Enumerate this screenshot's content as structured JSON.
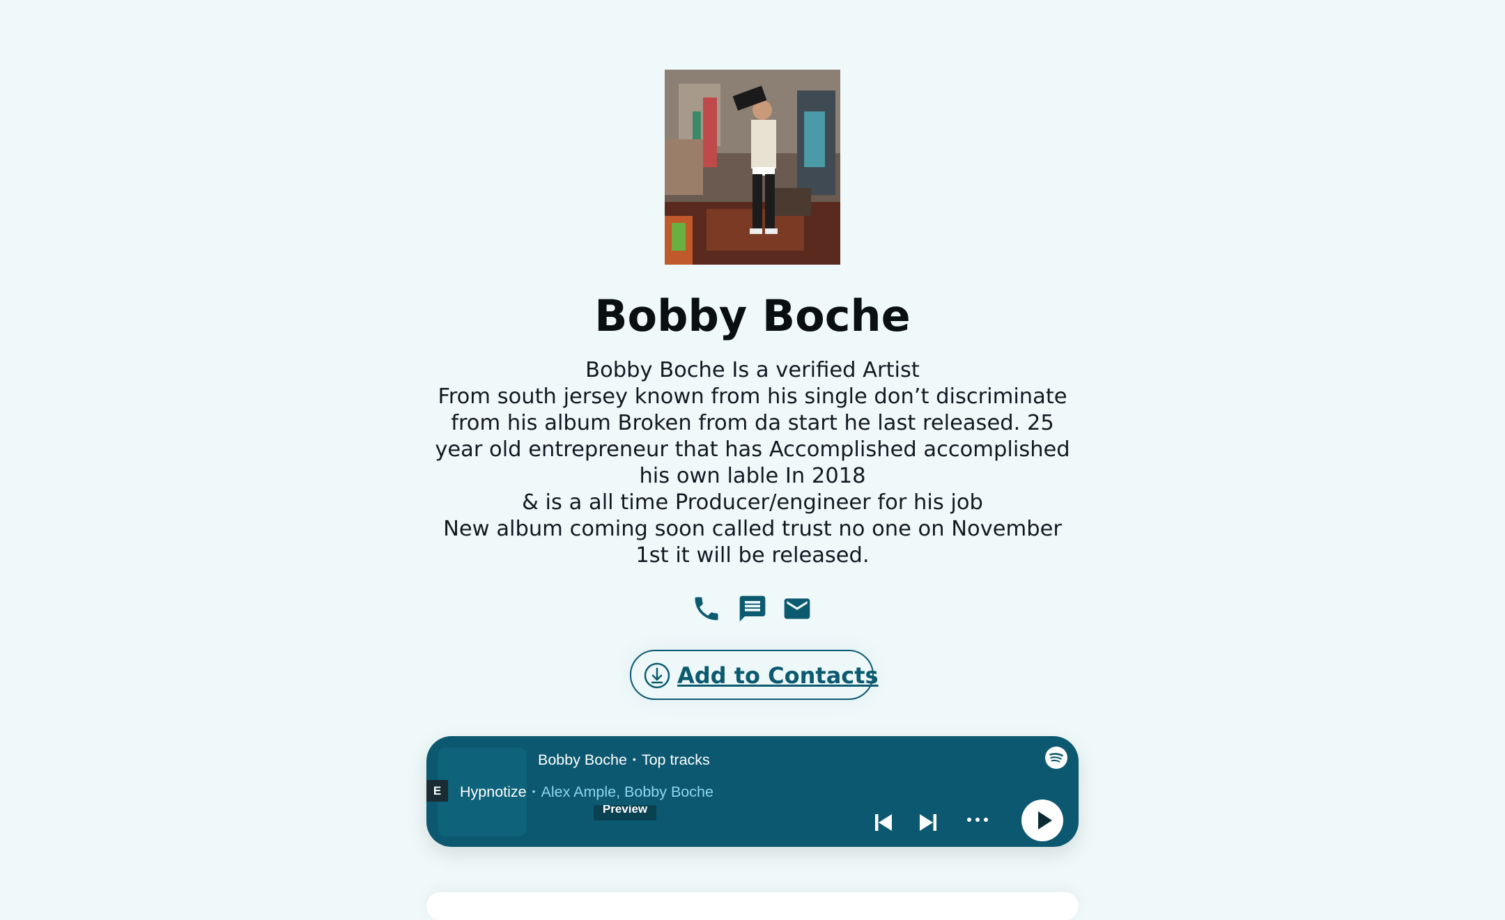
{
  "profile": {
    "name": "Bobby Boche",
    "bio_lines": [
      "Bobby Boche Is a verified Artist",
      "From south jersey known from his single don’t discriminate",
      "from his album Broken from da start he last released. 25",
      "year old entrepreneur that has Accomplished accomplished",
      "his own lable In 2018",
      "& is a all time Producer/engineer for his job",
      "New album coming soon called trust no one on November",
      "1st it will be released."
    ]
  },
  "contact_icons": [
    "phone-icon",
    "message-icon",
    "email-icon"
  ],
  "add_contacts": {
    "label": "Add to Contacts",
    "icon": "download-circle-icon"
  },
  "player": {
    "artist": "Bobby Boche",
    "header_suffix": "Top tracks",
    "explicit_badge": "E",
    "track_title": "Hypnotize",
    "track_artists": "Alex Ample, Bobby Boche",
    "preview_label": "Preview",
    "separator": "•",
    "controls": [
      "previous-icon",
      "next-icon",
      "more-icon",
      "play-icon"
    ],
    "background_color": "#0b5870"
  },
  "colors": {
    "accent": "#0b5a70",
    "page_background": "#f0f9fa"
  }
}
